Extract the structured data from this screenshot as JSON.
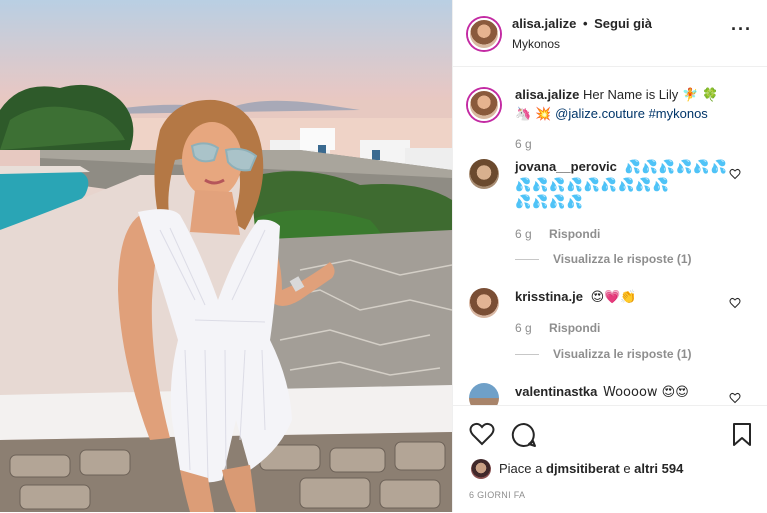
{
  "post": {
    "author": "alisa.jalize",
    "separator": "•",
    "follow_status": "Segui già",
    "location": "Mykonos",
    "more_icon": "more-options-icon"
  },
  "caption": {
    "username": "alisa.jalize",
    "text": "Her Name is Lily",
    "emojis_line1": "🧚 🍀",
    "emojis_line2": "🦄 💥",
    "mention": "@jalize.couture",
    "hashtag": "#mykonos",
    "age": "6 g"
  },
  "comments": [
    {
      "username": "jovana__perovic",
      "line1": "💦💦💦💦💦💦",
      "line2": "💦💦💦💦💦💦💦💦💦",
      "line3": "💦💦💦💦",
      "age": "6 g",
      "reply_label": "Rispondi",
      "view_replies": "Visualizza le risposte (1)"
    },
    {
      "username": "krisstina.je",
      "text": "😍💗👏",
      "age": "6 g",
      "reply_label": "Rispondi",
      "view_replies": "Visualizza le risposte (1)"
    },
    {
      "username": "valentinastka",
      "text": "Woooow 😍😍"
    }
  ],
  "actions": {
    "like_icon": "heart-icon",
    "comment_icon": "comment-icon",
    "save_icon": "bookmark-icon"
  },
  "likes": {
    "prefix": "Piace a",
    "user": "djmsitiberat",
    "middle": "e",
    "others": "altri 594"
  },
  "timestamp": "6 GIORNI FA",
  "colors": {
    "story_ring": "#c32aa3",
    "link": "#003569",
    "muted": "#8e8e8e",
    "text": "#262626"
  }
}
